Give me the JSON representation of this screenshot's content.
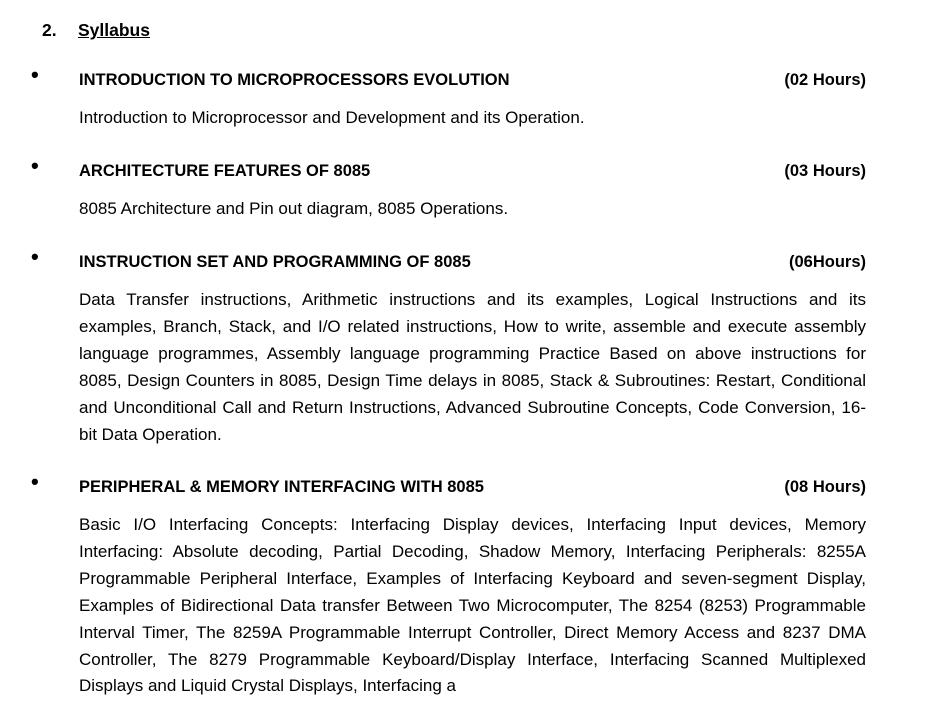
{
  "heading": {
    "number": "2.",
    "title": "Syllabus"
  },
  "sections": [
    {
      "bullet": "•",
      "title": "INTRODUCTION TO MICROPROCESSORS EVOLUTION",
      "hours": "(02 Hours)",
      "body": "Introduction to Microprocessor and Development and its Operation."
    },
    {
      "bullet": "•",
      "title": "ARCHITECTURE FEATURES OF 8085",
      "hours": "(03 Hours)",
      "body": "8085 Architecture and Pin out diagram, 8085 Operations."
    },
    {
      "bullet": "•",
      "title": "INSTRUCTION SET AND PROGRAMMING OF 8085",
      "hours": "(06Hours)",
      "body": "Data Transfer instructions, Arithmetic instructions and its examples, Logical Instructions and its examples, Branch, Stack, and I/O related instructions, How to write, assemble and execute assembly language programmes, Assembly language programming Practice Based on above instructions for 8085, Design Counters in 8085, Design Time delays in 8085, Stack & Subroutines: Restart, Conditional and Unconditional Call and Return Instructions, Advanced Subroutine Concepts, Code Conversion, 16-bit Data Operation."
    },
    {
      "bullet": "•",
      "title": "PERIPHERAL & MEMORY INTERFACING WITH 8085",
      "hours": "(08 Hours)",
      "body": "Basic I/O Interfacing Concepts: Interfacing Display devices, Interfacing Input devices, Memory Interfacing: Absolute decoding, Partial Decoding, Shadow Memory, Interfacing Peripherals: 8255A Programmable Peripheral Interface, Examples of Interfacing Keyboard and seven-segment Display, Examples of Bidirectional Data transfer Between Two Microcomputer, The 8254 (8253) Programmable Interval Timer, The 8259A Programmable Interrupt Controller, Direct Memory Access and 8237 DMA Controller, The 8279 Programmable Keyboard/Display Interface, Interfacing Scanned Multiplexed Displays and Liquid Crystal Displays, Interfacing a"
    }
  ]
}
